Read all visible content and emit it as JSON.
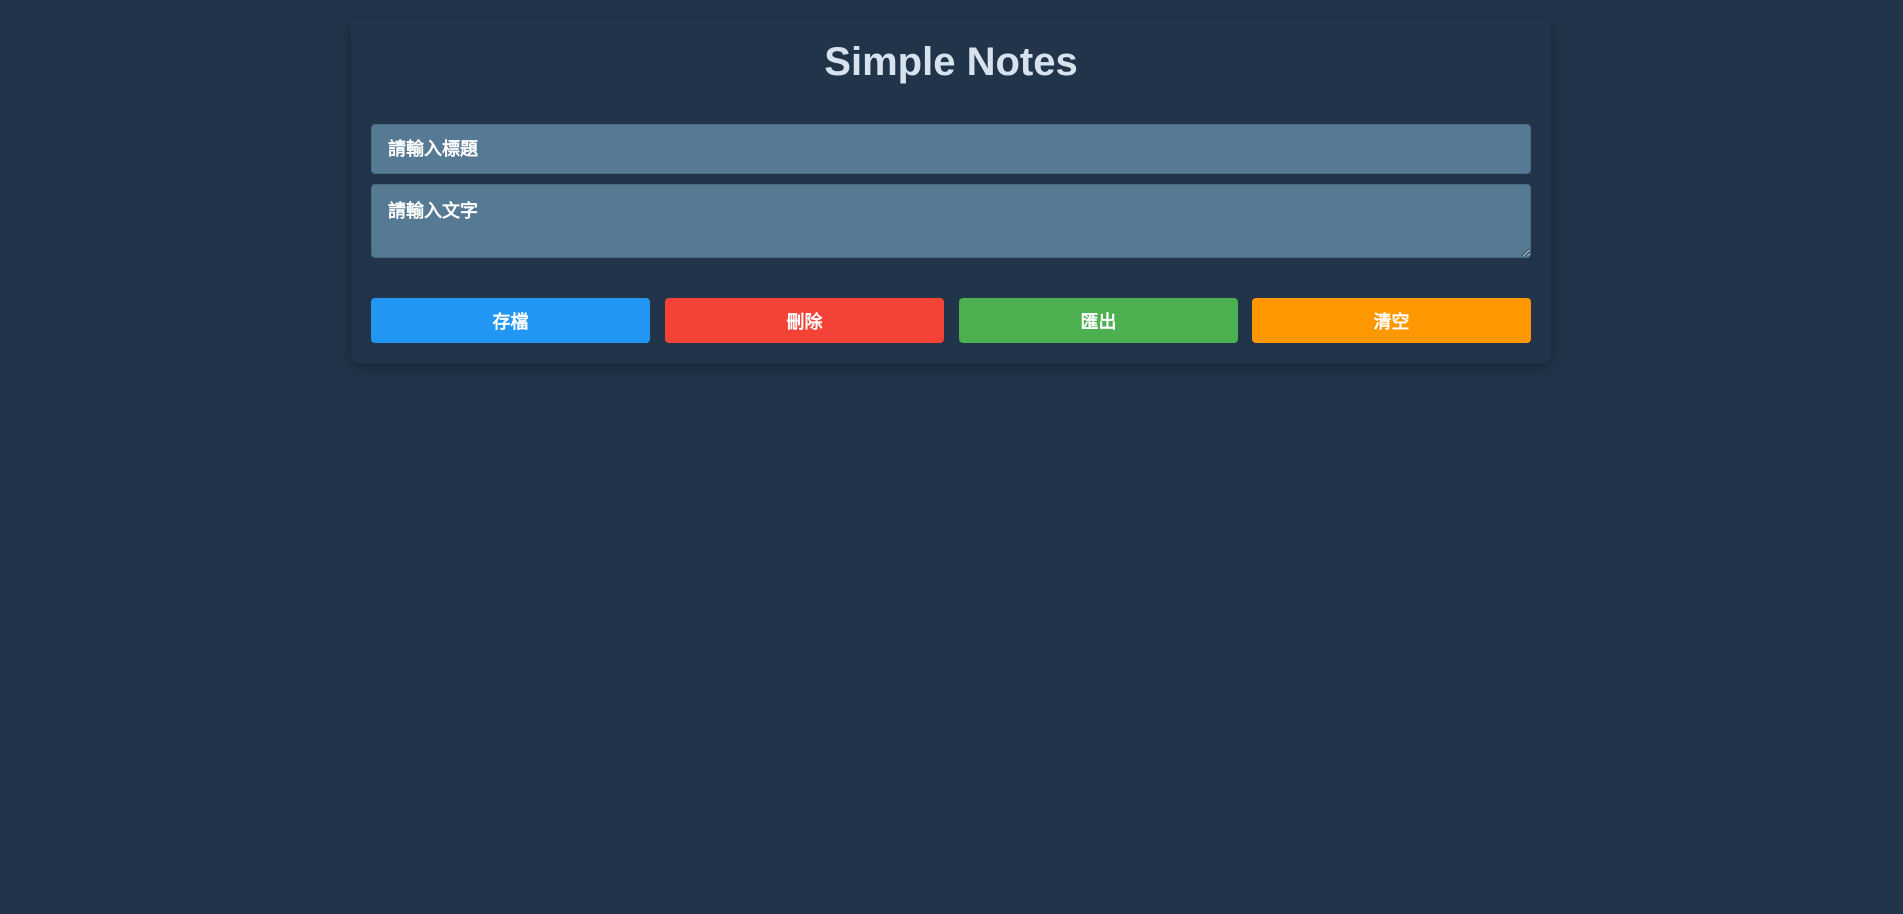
{
  "app": {
    "title": "Simple Notes"
  },
  "form": {
    "title_placeholder": "請輸入標題",
    "title_value": "",
    "content_placeholder": "請輸入文字",
    "content_value": ""
  },
  "buttons": [
    {
      "label": "存檔",
      "color": "#2196f3"
    },
    {
      "label": "刪除",
      "color": "#f44336"
    },
    {
      "label": "匯出",
      "color": "#4caf50"
    },
    {
      "label": "清空",
      "color": "#ff9800"
    }
  ]
}
